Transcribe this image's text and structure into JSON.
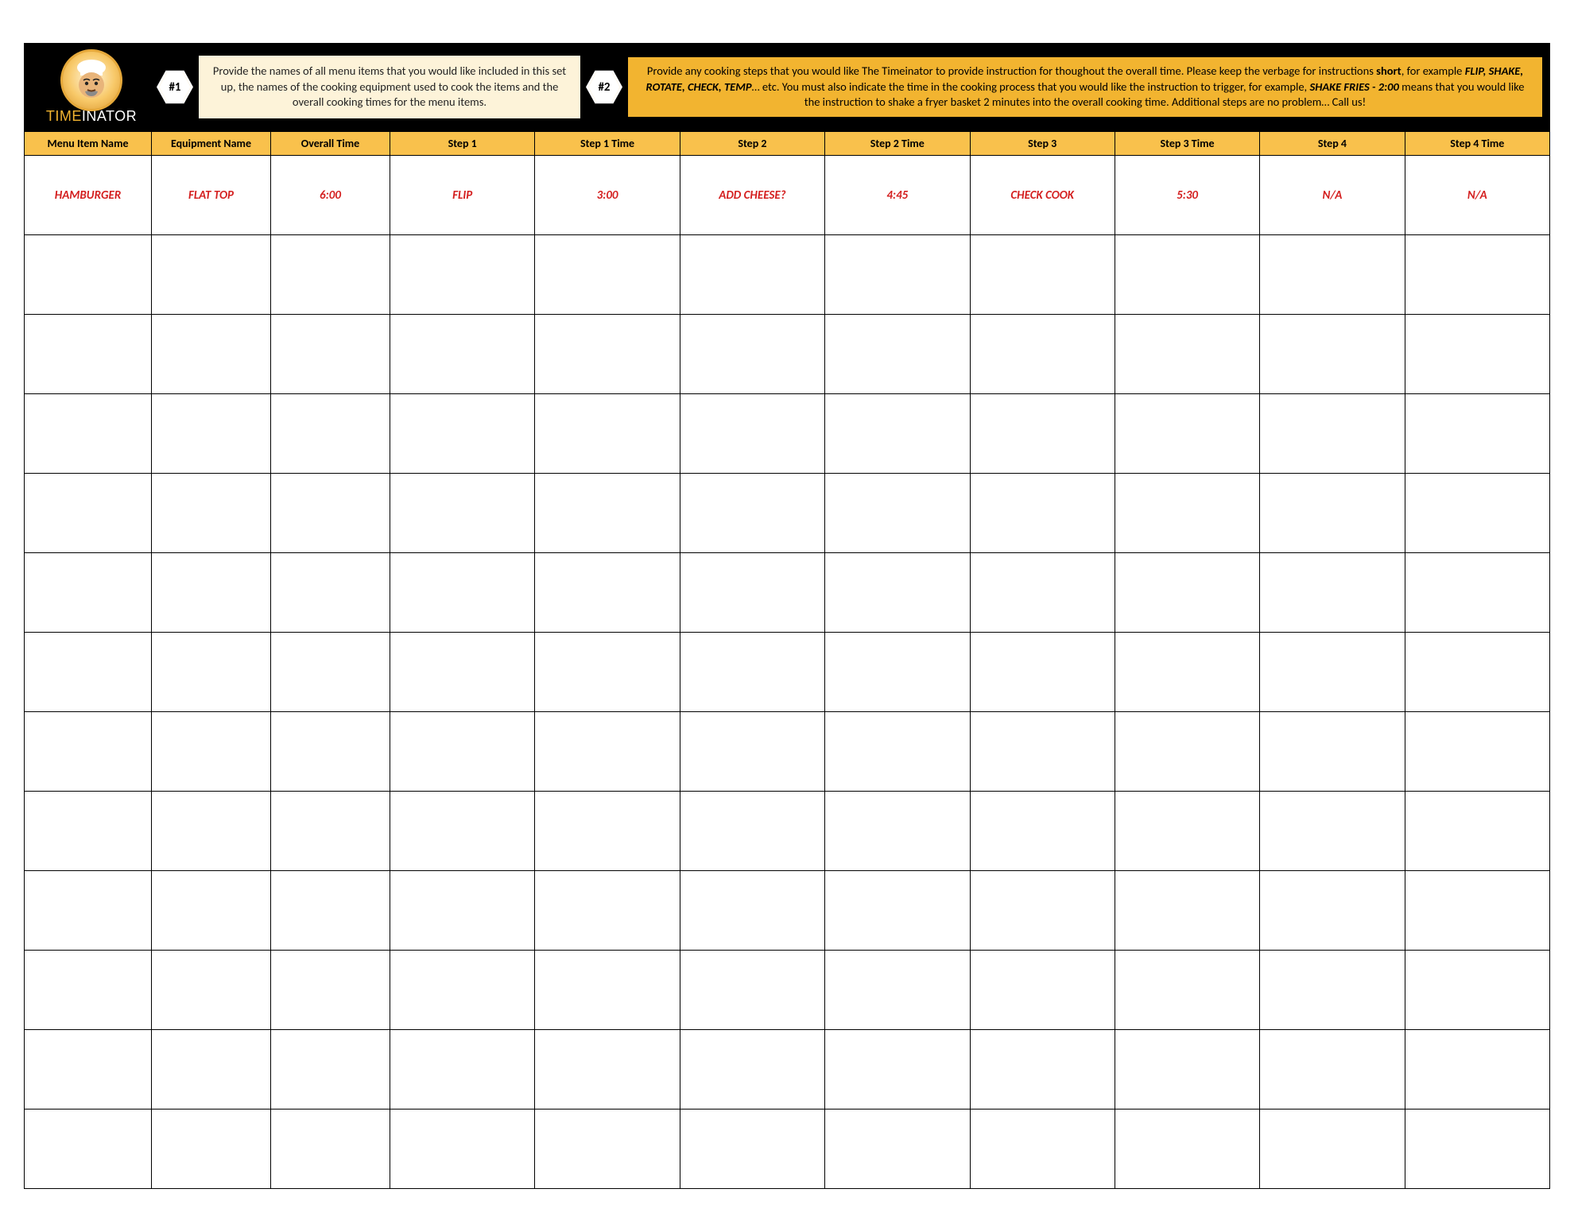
{
  "logo": {
    "part1": "TIME",
    "part2": "INATOR"
  },
  "badge1": "#1",
  "badge2": "#2",
  "info1": "Provide the names of all menu items that you would like included in this set up, the names of the cooking equipment used to cook the items and the overall cooking times for the menu items.",
  "info2_pre": "Provide any cooking steps that you would like The Timeinator to provide instruction for thoughout the overall time. Please keep the verbage for instructions ",
  "info2_b1": "short",
  "info2_mid1": ", for example ",
  "info2_b2": "FLIP, SHAKE, ROTATE, CHECK, TEMP",
  "info2_mid2": "… etc. You must also indicate the time in the cooking process that you would like the instruction to trigger, for example, ",
  "info2_b3": "SHAKE FRIES - 2:00",
  "info2_post": " means that you would like the instruction to shake a fryer basket 2 minutes into the overall cooking time. Additional steps are no problem… Call us!",
  "headers": {
    "c0": "Menu Item Name",
    "c1": "Equipment Name",
    "c2": "Overall  Time",
    "c3": "Step 1",
    "c4": "Step 1 Time",
    "c5": "Step 2",
    "c6": "Step 2 Time",
    "c7": "Step 3",
    "c8": "Step 3 Time",
    "c9": "Step 4",
    "c10": "Step 4 Time"
  },
  "example": {
    "c0": "HAMBURGER",
    "c1": "FLAT TOP",
    "c2": "6:00",
    "c3": "FLIP",
    "c4": "3:00",
    "c5": "ADD CHEESE?",
    "c6": "4:45",
    "c7": "CHECK COOK",
    "c8": "5:30",
    "c9": "N/A",
    "c10": "N/A"
  },
  "blank_rows": 12
}
